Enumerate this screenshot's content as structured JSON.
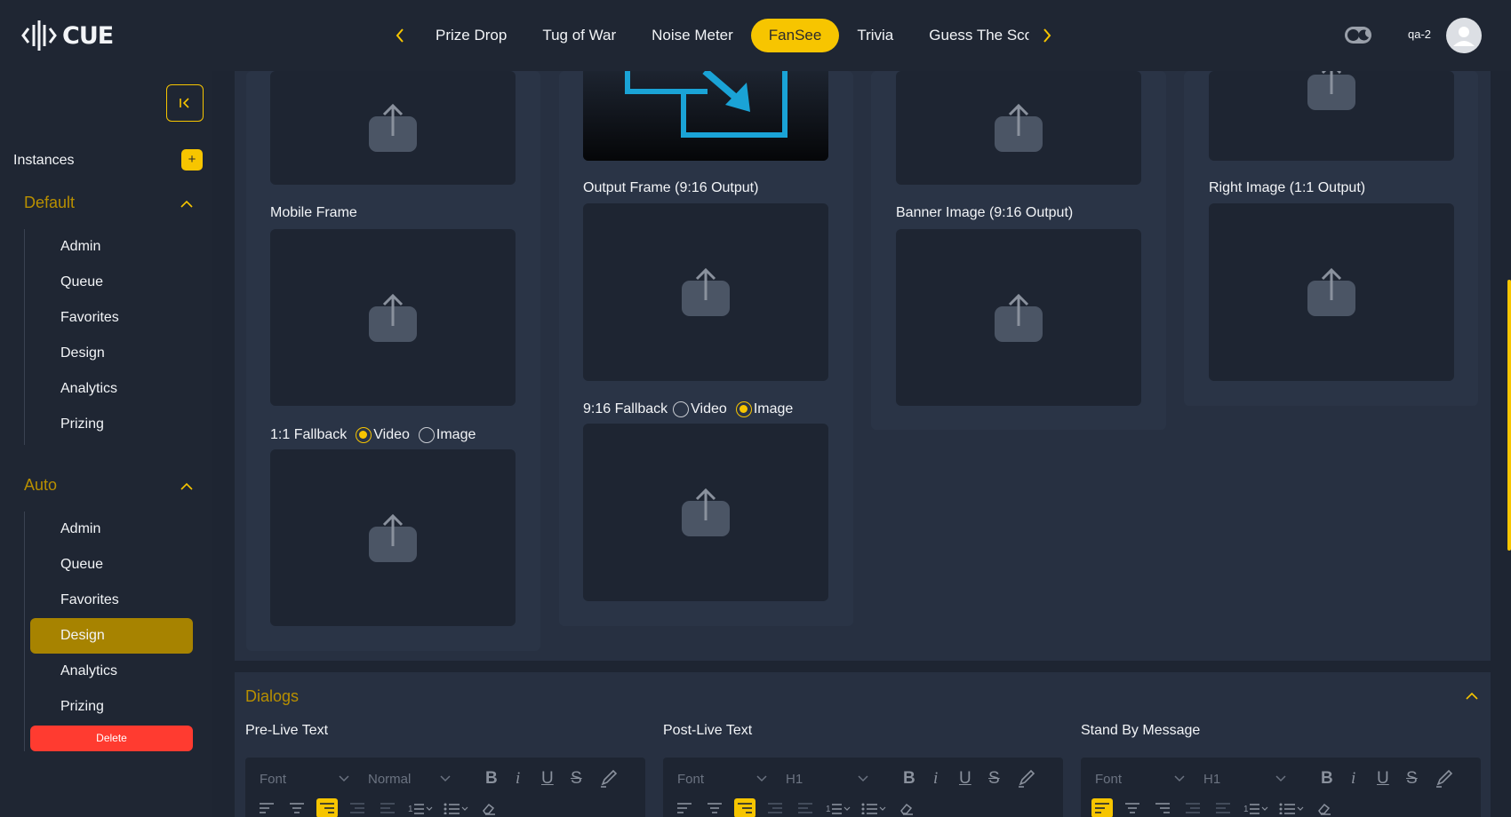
{
  "app": {
    "logo_text": "CUE"
  },
  "tabs": [
    "Prize Drop",
    "Tug of War",
    "Noise Meter",
    "FanSee",
    "Trivia",
    "Guess The Sco"
  ],
  "active_tab": "FanSee",
  "user": {
    "name": "qa-2"
  },
  "sidebar": {
    "instances_label": "Instances",
    "add_label": "+",
    "groups": [
      {
        "title": "Default",
        "items": [
          "Admin",
          "Queue",
          "Favorites",
          "Design",
          "Analytics",
          "Prizing"
        ]
      },
      {
        "title": "Auto",
        "items": [
          "Admin",
          "Queue",
          "Favorites",
          "Design",
          "Analytics",
          "Prizing"
        ],
        "active_item": "Design"
      }
    ],
    "delete_label": "Delete"
  },
  "design": {
    "col1": {
      "mobile_frame_label": "Mobile Frame",
      "fallback_label": "1:1 Fallback",
      "video_label": "Video",
      "image_label": "Image",
      "selected": "Video"
    },
    "col2": {
      "output_frame_label": "Output Frame (9:16 Output)",
      "fallback_label": "9:16 Fallback",
      "video_label": "Video",
      "image_label": "Image",
      "selected": "Image"
    },
    "col3": {
      "banner_label": "Banner Image (9:16 Output)"
    },
    "col4": {
      "right_image_label": "Right Image (1:1 Output)"
    }
  },
  "dialogs": {
    "title": "Dialogs",
    "editors": [
      {
        "label": "Pre-Live Text",
        "font": "Font",
        "style": "Normal",
        "active_align": "left-center"
      },
      {
        "label": "Post-Live Text",
        "font": "Font",
        "style": "H1",
        "active_align": "left-center"
      },
      {
        "label": "Stand By Message",
        "font": "Font",
        "style": "H1",
        "active_align": "left"
      }
    ]
  },
  "colors": {
    "accent": "#f7c500",
    "bg": "#1e2532",
    "panel": "#273041",
    "card": "#2a3446",
    "danger": "#ff3b30",
    "brand_blue": "#1aa3d6"
  }
}
